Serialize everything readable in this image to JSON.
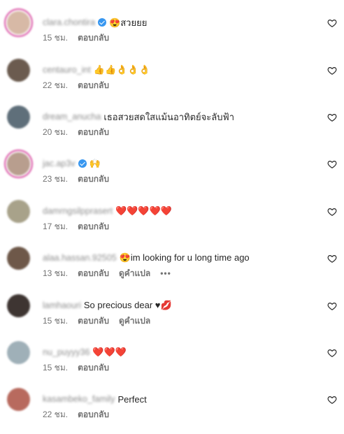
{
  "comments": [
    {
      "username": "clara.chontira",
      "verified": true,
      "text": "😍สวยยย",
      "time": "15 ชม.",
      "reply": "ตอบกลับ",
      "translate": "",
      "more": "",
      "ring": true,
      "avatar_color": "#d7b9a6"
    },
    {
      "username": "centauro_int",
      "verified": false,
      "text": "👍👍👌👌👌",
      "time": "22 ชม.",
      "reply": "ตอบกลับ",
      "translate": "",
      "more": "",
      "ring": false,
      "avatar_color": "#6b5b4f"
    },
    {
      "username": "dream_anucha",
      "verified": false,
      "text": "เธอสวยสดใสแม้นอาทิตย์จะลับฟ้า",
      "time": "20 ชม.",
      "reply": "ตอบกลับ",
      "translate": "",
      "more": "",
      "ring": false,
      "avatar_color": "#5f6f7a"
    },
    {
      "username": "jac.ap3v",
      "verified": true,
      "text": "🙌",
      "time": "23 ชม.",
      "reply": "ตอบกลับ",
      "translate": "",
      "more": "",
      "ring": true,
      "avatar_color": "#b89e8e"
    },
    {
      "username": "damrngsilpprasert",
      "verified": false,
      "text": "❤️❤️❤️❤️❤️",
      "time": "17 ชม.",
      "reply": "ตอบกลับ",
      "translate": "",
      "more": "",
      "ring": false,
      "avatar_color": "#a8a28a"
    },
    {
      "username": "alaa.hassan.92505",
      "verified": false,
      "text": "😍im looking for u long time ago",
      "time": "13 ชม.",
      "reply": "ตอบกลับ",
      "translate": "ดูคำแปล",
      "more": "•••",
      "ring": false,
      "avatar_color": "#6e5849"
    },
    {
      "username": "lamhaouri",
      "verified": false,
      "text": "So precious dear ♥💋",
      "time": "15 ชม.",
      "reply": "ตอบกลับ",
      "translate": "ดูคำแปล",
      "more": "",
      "ring": false,
      "avatar_color": "#3e3532"
    },
    {
      "username": "nu_puyyy36",
      "verified": false,
      "text": "❤️❤️❤️",
      "time": "15 ชม.",
      "reply": "ตอบกลับ",
      "translate": "",
      "more": "",
      "ring": false,
      "avatar_color": "#9fb0b8"
    },
    {
      "username": "kasambeko_family",
      "verified": false,
      "text": "Perfect",
      "time": "22 ชม.",
      "reply": "ตอบกลับ",
      "translate": "",
      "more": "",
      "ring": false,
      "avatar_color": "#b86a5e"
    }
  ]
}
